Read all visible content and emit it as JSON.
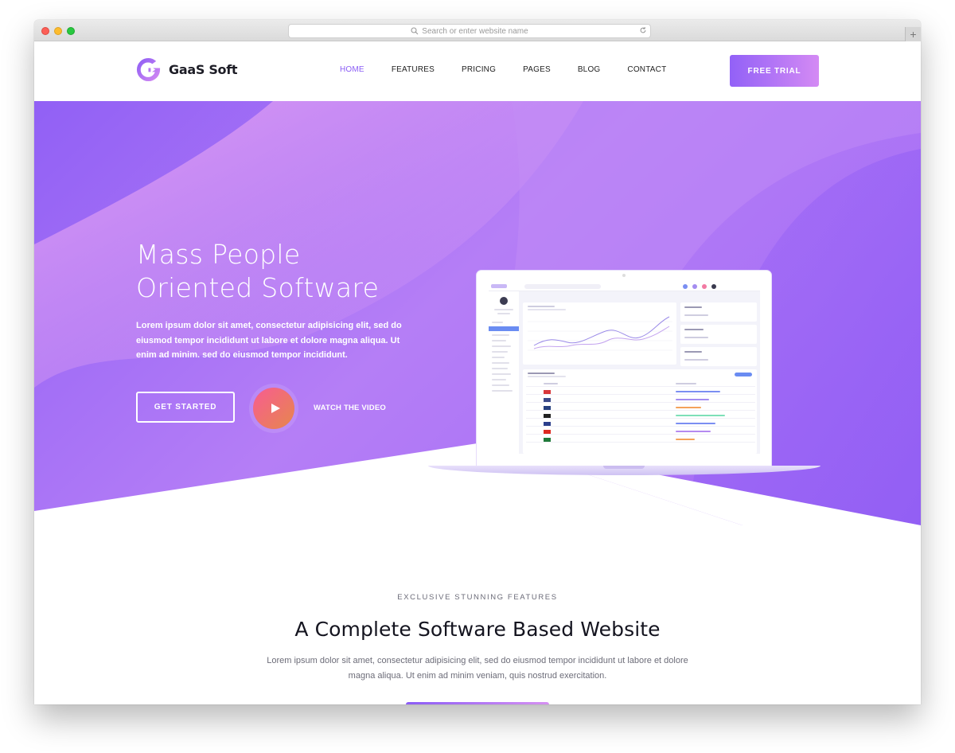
{
  "browser": {
    "url_placeholder": "Search or enter website name",
    "new_tab_label": "+"
  },
  "brand": {
    "name": "GaaS Soft",
    "colors": {
      "accent": "#8a5cf5",
      "gradient_start": "#9261f7",
      "gradient_end": "#d48af4"
    }
  },
  "nav": {
    "items": [
      {
        "label": "HOME",
        "active": true
      },
      {
        "label": "FEATURES",
        "active": false
      },
      {
        "label": "PRICING",
        "active": false
      },
      {
        "label": "PAGES",
        "active": false
      },
      {
        "label": "BLOG",
        "active": false
      },
      {
        "label": "CONTACT",
        "active": false
      }
    ],
    "cta_label": "FREE TRIAL"
  },
  "hero": {
    "title_line1": "Mass People",
    "title_line2": "Oriented Software",
    "description": "Lorem ipsum dolor sit amet, consectetur adipisicing elit, sed do eiusmod tempor incididunt ut labore et dolore magna aliqua. Ut enim ad minim. sed do eiusmod tempor incididunt.",
    "primary_button": "GET STARTED",
    "video_label": "WATCH THE VIDEO"
  },
  "features": {
    "eyebrow": "EXCLUSIVE STUNNING FEATURES",
    "title": "A Complete Software Based Website",
    "description": "Lorem ipsum dolor sit amet, consectetur adipisicing elit, sed do eiusmod tempor incididunt ut labore et dolore magna aliqua. Ut enim ad minim veniam, quis nostrud exercitation."
  }
}
